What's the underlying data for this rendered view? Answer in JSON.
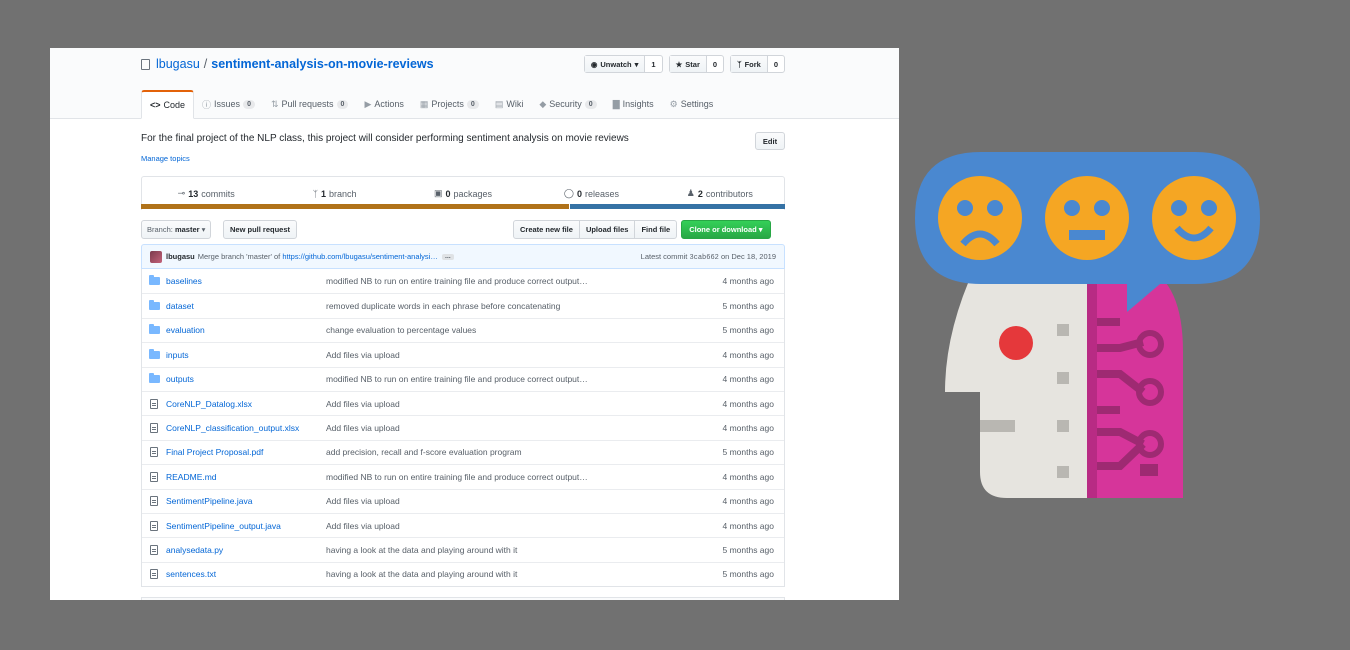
{
  "repo": {
    "owner": "lbugasu",
    "separator": "/",
    "name": "sentiment-analysis-on-movie-reviews"
  },
  "actions": {
    "watch_label": "Unwatch",
    "watch_count": "1",
    "star_label": "Star",
    "star_count": "0",
    "fork_label": "Fork",
    "fork_count": "0"
  },
  "tabs": [
    {
      "label": "Code",
      "count": ""
    },
    {
      "label": "Issues",
      "count": "0"
    },
    {
      "label": "Pull requests",
      "count": "0"
    },
    {
      "label": "Actions",
      "count": ""
    },
    {
      "label": "Projects",
      "count": "0"
    },
    {
      "label": "Wiki",
      "count": ""
    },
    {
      "label": "Security",
      "count": "0"
    },
    {
      "label": "Insights",
      "count": ""
    },
    {
      "label": "Settings",
      "count": ""
    }
  ],
  "description": "For the final project of the NLP class, this project will consider performing sentiment analysis on movie reviews",
  "manage_topics": "Manage topics",
  "edit_label": "Edit",
  "numbers": {
    "commits_count": "13",
    "commits_label": "commits",
    "branch_count": "1",
    "branch_label": "branch",
    "packages_count": "0",
    "packages_label": "packages",
    "releases_count": "0",
    "releases_label": "releases",
    "contributors_count": "2",
    "contributors_label": "contributors"
  },
  "language_colors": {
    "java": "#b07219",
    "python": "#3572a5"
  },
  "branch_select": {
    "prefix": "Branch:",
    "value": "master"
  },
  "new_pr_label": "New pull request",
  "file_nav": {
    "create": "Create new file",
    "upload": "Upload files",
    "find": "Find file",
    "clone": "Clone or download"
  },
  "commit": {
    "author": "lbugasu",
    "message": "Merge branch 'master' of",
    "link": "https://github.com/lbugasu/sentiment-analysi…",
    "dots": "…",
    "latest_prefix": "Latest commit",
    "sha": "3cab662",
    "date": "on Dec 18, 2019"
  },
  "files": [
    {
      "type": "dir",
      "name": "baselines",
      "message": "modified NB to run on entire training file and produce correct output…",
      "age": "4 months ago"
    },
    {
      "type": "dir",
      "name": "dataset",
      "message": "removed duplicate words in each phrase before concatenating",
      "age": "5 months ago"
    },
    {
      "type": "dir",
      "name": "evaluation",
      "message": "change evaluation to percentage values",
      "age": "5 months ago"
    },
    {
      "type": "dir",
      "name": "inputs",
      "message": "Add files via upload",
      "age": "4 months ago"
    },
    {
      "type": "dir",
      "name": "outputs",
      "message": "modified NB to run on entire training file and produce correct output…",
      "age": "4 months ago"
    },
    {
      "type": "file",
      "name": "CoreNLP_Datalog.xlsx",
      "message": "Add files via upload",
      "age": "4 months ago"
    },
    {
      "type": "file",
      "name": "CoreNLP_classification_output.xlsx",
      "message": "Add files via upload",
      "age": "4 months ago"
    },
    {
      "type": "file",
      "name": "Final Project Proposal.pdf",
      "message": "add precision, recall and f-score evaluation program",
      "age": "5 months ago"
    },
    {
      "type": "file",
      "name": "README.md",
      "message": "modified NB to run on entire training file and produce correct output…",
      "age": "4 months ago"
    },
    {
      "type": "file",
      "name": "SentimentPipeline.java",
      "message": "Add files via upload",
      "age": "4 months ago"
    },
    {
      "type": "file",
      "name": "SentimentPipeline_output.java",
      "message": "Add files via upload",
      "age": "4 months ago"
    },
    {
      "type": "file",
      "name": "analysedata.py",
      "message": "having a look at the data and playing around with it",
      "age": "5 months ago"
    },
    {
      "type": "file",
      "name": "sentences.txt",
      "message": "having a look at the data and playing around with it",
      "age": "5 months ago"
    }
  ],
  "illustration": {
    "faces": [
      "sad-face-icon",
      "neutral-face-icon",
      "happy-face-icon"
    ],
    "colors": {
      "bubble": "#4a88d0",
      "face": "#f5a623",
      "head_left": "#e6e4df",
      "head_right": "#d6359a",
      "eye": "#e5383b"
    }
  }
}
